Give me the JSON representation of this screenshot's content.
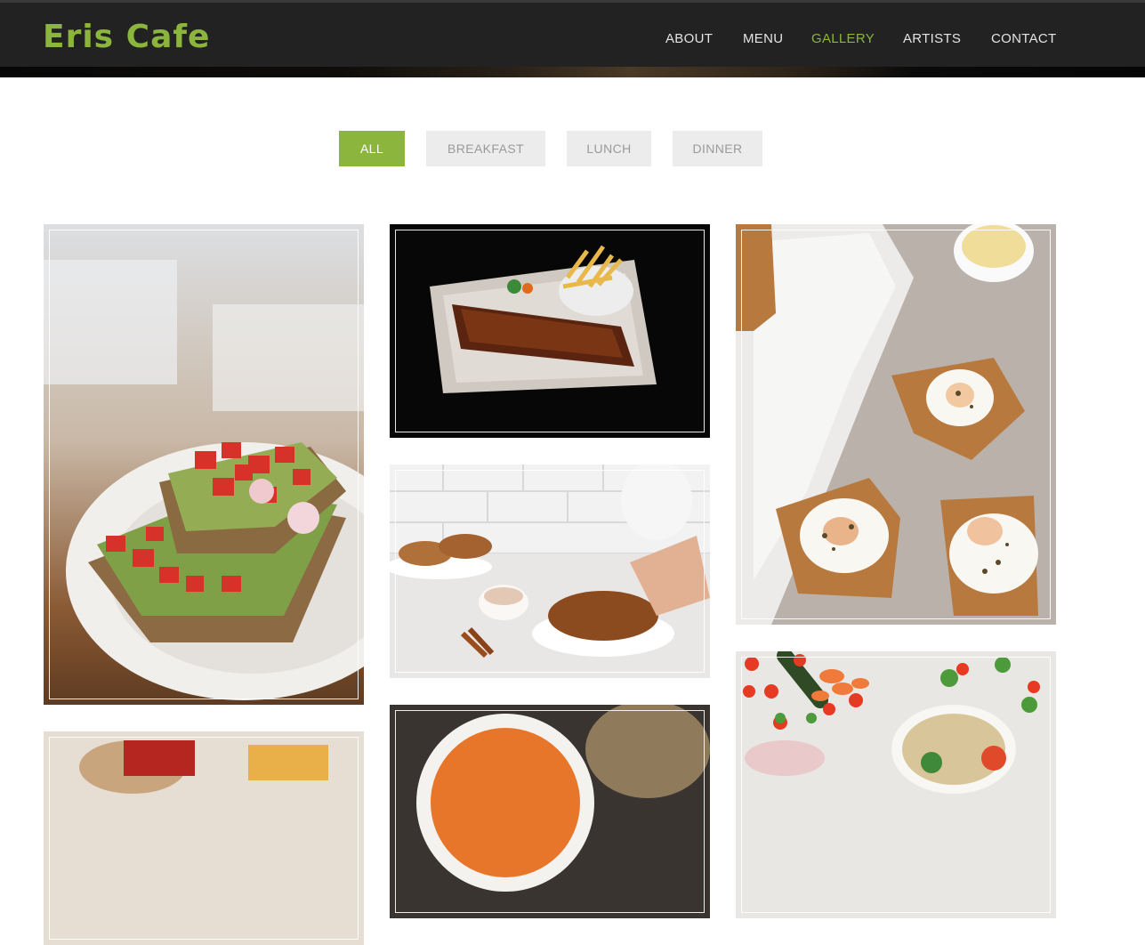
{
  "header": {
    "brand": "Eris Cafe",
    "nav": [
      {
        "label": "ABOUT",
        "active": false
      },
      {
        "label": "MENU",
        "active": false
      },
      {
        "label": "GALLERY",
        "active": true
      },
      {
        "label": "ARTISTS",
        "active": false
      },
      {
        "label": "CONTACT",
        "active": false
      }
    ]
  },
  "filters": [
    {
      "label": "ALL",
      "active": true
    },
    {
      "label": "BREAKFAST",
      "active": false
    },
    {
      "label": "LUNCH",
      "active": false
    },
    {
      "label": "DINNER",
      "active": false
    }
  ],
  "gallery": [
    {
      "name": "avocado-tomato-toast-photo"
    },
    {
      "name": "bbq-ribs-with-fries-photo"
    },
    {
      "name": "pastry-and-cinnamon-photo"
    },
    {
      "name": "tomato-soup-bowl-photo"
    },
    {
      "name": "waffles-with-eggs-photo"
    },
    {
      "name": "vegetables-salad-photo"
    },
    {
      "name": "pizza-slice-photo"
    }
  ],
  "colors": {
    "accent": "#8cb53d",
    "header_bg": "#222222",
    "filter_bg": "#ececec"
  }
}
